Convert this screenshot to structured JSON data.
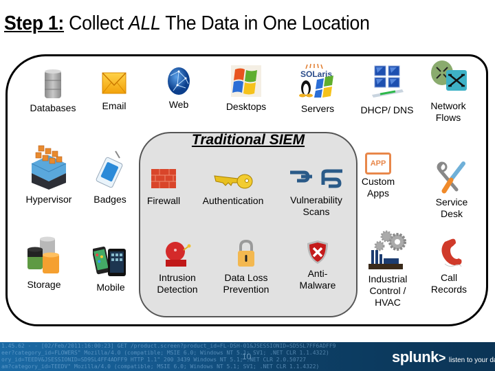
{
  "title": {
    "step": "Step 1:",
    "pre": " Collect ",
    "emphasis": "ALL",
    "post": " The Data in One Location"
  },
  "siem": {
    "title": "Traditional SIEM",
    "items": [
      {
        "label": "Firewall",
        "icon": "firewall-brick-icon"
      },
      {
        "label": "Authentication",
        "icon": "key-icon"
      },
      {
        "label": "Vulnerability\nScans",
        "icon": "broken-chain-icon"
      },
      {
        "label": "Intrusion\nDetection",
        "icon": "alarm-bell-icon"
      },
      {
        "label": "Data Loss\nPrevention",
        "icon": "padlock-icon"
      },
      {
        "label": "Anti-\nMalware",
        "icon": "shield-x-icon"
      }
    ]
  },
  "sources": {
    "top": [
      {
        "label": "Databases",
        "icon": "database-icon"
      },
      {
        "label": "Email",
        "icon": "envelope-icon"
      },
      {
        "label": "Web",
        "icon": "globe-icon"
      },
      {
        "label": "Desktops",
        "icon": "windows-logo-icon"
      },
      {
        "label": "Servers",
        "icon": "solaris-linux-windows-icon"
      },
      {
        "label": "DHCP/ DNS",
        "icon": "network-computers-icon"
      },
      {
        "label": "Network\nFlows",
        "icon": "router-switch-icon"
      }
    ],
    "left": [
      {
        "label": "Hypervisor",
        "icon": "hypervisor-icon"
      },
      {
        "label": "Badges",
        "icon": "badge-icon"
      },
      {
        "label": "Storage",
        "icon": "storage-cylinders-icon"
      },
      {
        "label": "Mobile",
        "icon": "mobile-devices-icon"
      }
    ],
    "right": [
      {
        "label": "Custom\nApps",
        "icon": "app-icon",
        "icon_text": "APP"
      },
      {
        "label": "Service\nDesk",
        "icon": "tools-icon"
      },
      {
        "label": "Industrial\nControl /\nHVAC",
        "icon": "factory-gears-icon"
      },
      {
        "label": "Call\nRecords",
        "icon": "phone-handset-icon"
      }
    ]
  },
  "footer": {
    "page_number": "10",
    "brand": "splunk",
    "brand_arrow": ">",
    "tagline": "listen to your data™",
    "log_lines": [
      "1.45.62 - - [02/Feb/2011:16:00:23] GET /product.screen?product_id=FL-DSH-01&JSESSIONID=SD5SL7FF6ADFF9",
      "eer?category_id=FLOWERS\" Mozilla/4.0 (compatible; MSIE 6.0; Windows NT 5.1; SV1; .NET CLR 1.1.4322)",
      "ory_id=TEEDV&JSESSIONID=SD9SL4FF4ADFF9 HTTP 1.1\" 200 3439 Windows NT 5.1; .NET CLR 2.0.50727",
      "am?category_id=TEEDV\" Mozilla/4.0 (compatible; MSIE 6.0; Windows NT 5.1; SV1; .NET CLR 1.1.4322)"
    ]
  },
  "colors": {
    "siem_fill": "#e1e1e1",
    "footer_blue": "#0d3f66",
    "app_orange": "#e8874a"
  }
}
